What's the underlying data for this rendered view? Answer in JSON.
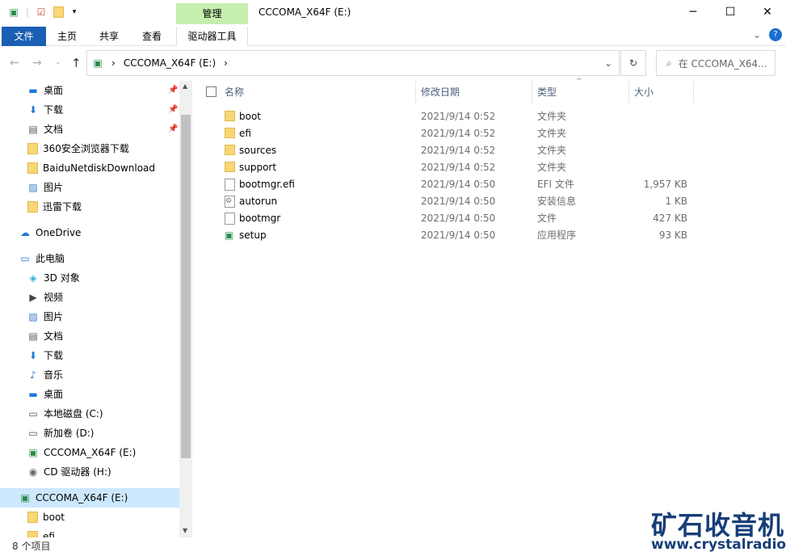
{
  "window": {
    "title": "CCCOMA_X64F (E:)",
    "minimize": "─",
    "maximize": "☐",
    "close": "✕"
  },
  "ribbon": {
    "context_group": "管理",
    "tabs": [
      "文件",
      "主页",
      "共享",
      "查看",
      "驱动器工具"
    ]
  },
  "address": {
    "path": "CCCOMA_X64F (E:)",
    "search_placeholder": "在 CCCOMA_X64..."
  },
  "nav": {
    "items": [
      {
        "label": "桌面",
        "icon": "desktop",
        "pinned": true
      },
      {
        "label": "下载",
        "icon": "download",
        "pinned": true
      },
      {
        "label": "文档",
        "icon": "document",
        "pinned": true
      },
      {
        "label": "360安全浏览器下载",
        "icon": "folder"
      },
      {
        "label": "BaiduNetdiskDownload",
        "icon": "folder"
      },
      {
        "label": "图片",
        "icon": "pictures"
      },
      {
        "label": "迅雷下载",
        "icon": "folder"
      },
      {
        "label": "OneDrive",
        "icon": "cloud"
      },
      {
        "label": "此电脑",
        "icon": "computer"
      },
      {
        "label": "3D 对象",
        "icon": "3d"
      },
      {
        "label": "视频",
        "icon": "video"
      },
      {
        "label": "图片",
        "icon": "pictures"
      },
      {
        "label": "文档",
        "icon": "document"
      },
      {
        "label": "下载",
        "icon": "download"
      },
      {
        "label": "音乐",
        "icon": "music"
      },
      {
        "label": "桌面",
        "icon": "desktop"
      },
      {
        "label": "本地磁盘 (C:)",
        "icon": "drive"
      },
      {
        "label": "新加卷 (D:)",
        "icon": "drive"
      },
      {
        "label": "CCCOMA_X64F (E:)",
        "icon": "install-drive"
      },
      {
        "label": "CD 驱动器 (H:)",
        "icon": "cd"
      },
      {
        "label": "CCCOMA_X64F (E:)",
        "icon": "install-drive",
        "selected": true
      },
      {
        "label": "boot",
        "icon": "folder"
      },
      {
        "label": "efi",
        "icon": "folder"
      }
    ]
  },
  "columns": {
    "name": "名称",
    "date": "修改日期",
    "type": "类型",
    "size": "大小"
  },
  "files": [
    {
      "name": "boot",
      "date": "2021/9/14 0:52",
      "type": "文件夹",
      "size": "",
      "icon": "folder"
    },
    {
      "name": "efi",
      "date": "2021/9/14 0:52",
      "type": "文件夹",
      "size": "",
      "icon": "folder"
    },
    {
      "name": "sources",
      "date": "2021/9/14 0:52",
      "type": "文件夹",
      "size": "",
      "icon": "folder"
    },
    {
      "name": "support",
      "date": "2021/9/14 0:52",
      "type": "文件夹",
      "size": "",
      "icon": "folder"
    },
    {
      "name": "bootmgr.efi",
      "date": "2021/9/14 0:50",
      "type": "EFI 文件",
      "size": "1,957 KB",
      "icon": "file"
    },
    {
      "name": "autorun",
      "date": "2021/9/14 0:50",
      "type": "安装信息",
      "size": "1 KB",
      "icon": "settings-file"
    },
    {
      "name": "bootmgr",
      "date": "2021/9/14 0:50",
      "type": "文件",
      "size": "427 KB",
      "icon": "file"
    },
    {
      "name": "setup",
      "date": "2021/9/14 0:50",
      "type": "应用程序",
      "size": "93 KB",
      "icon": "setup"
    }
  ],
  "status": {
    "count": "8 个项目"
  },
  "watermark": {
    "title": "矿石收音机",
    "url": "www.crystalradio.cn"
  }
}
